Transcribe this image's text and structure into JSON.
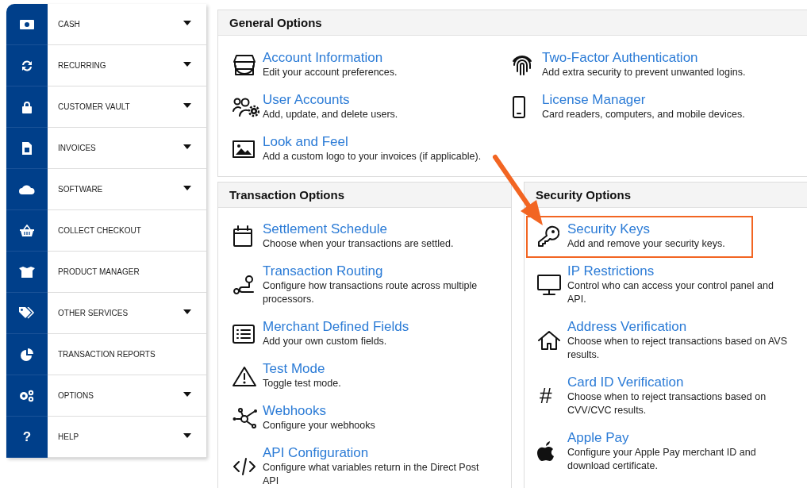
{
  "sidebar": {
    "items": [
      {
        "label": "CASH",
        "has_submenu": true
      },
      {
        "label": "RECURRING",
        "has_submenu": true
      },
      {
        "label": "CUSTOMER VAULT",
        "has_submenu": true
      },
      {
        "label": "INVOICES",
        "has_submenu": true
      },
      {
        "label": "SOFTWARE",
        "has_submenu": true
      },
      {
        "label": "COLLECT CHECKOUT",
        "has_submenu": false
      },
      {
        "label": "PRODUCT MANAGER",
        "has_submenu": false
      },
      {
        "label": "OTHER SERVICES",
        "has_submenu": true
      },
      {
        "label": "TRANSACTION REPORTS",
        "has_submenu": false
      },
      {
        "label": "OPTIONS",
        "has_submenu": true
      },
      {
        "label": "HELP",
        "has_submenu": true,
        "glyph": "?"
      }
    ]
  },
  "general_options": {
    "title": "General Options",
    "columns": [
      [
        {
          "title": "Account Information",
          "description": "Edit your account preferences.",
          "highlighted": false
        },
        {
          "title": "User Accounts",
          "description": "Add, update, and delete users.",
          "highlighted": false
        },
        {
          "title": "Look and Feel",
          "description": "Add a custom logo to your invoices (if applicable).",
          "highlighted": false
        }
      ],
      [
        {
          "title": "Two-Factor Authentication",
          "description": "Add extra security to prevent unwanted logins.",
          "highlighted": false
        },
        {
          "title": "License Manager",
          "description": "Card readers, computers, and mobile devices.",
          "highlighted": false
        }
      ]
    ]
  },
  "transaction_options": {
    "title": "Transaction Options",
    "items": [
      {
        "title": "Settlement Schedule",
        "description": "Choose when your transactions are settled.",
        "highlighted": false
      },
      {
        "title": "Transaction Routing",
        "description": "Configure how transactions route across multiple processors.",
        "highlighted": false
      },
      {
        "title": "Merchant Defined Fields",
        "description": "Add your own custom fields.",
        "highlighted": false
      },
      {
        "title": "Test Mode",
        "description": "Toggle test mode.",
        "highlighted": false
      },
      {
        "title": "Webhooks",
        "description": "Configure your webhooks",
        "highlighted": false
      },
      {
        "title": "API Configuration",
        "description": "Configure what variables return in the Direct Post API",
        "highlighted": false
      }
    ]
  },
  "security_options": {
    "title": "Security Options",
    "items": [
      {
        "title": "Security Keys",
        "description": "Add and remove your security keys.",
        "highlighted": true
      },
      {
        "title": "IP Restrictions",
        "description": "Control who can access your control panel and API.",
        "highlighted": false
      },
      {
        "title": "Address Verification",
        "description": "Choose when to reject transactions based on AVS results.",
        "highlighted": false
      },
      {
        "title": "Card ID Verification",
        "description": "Choose when to reject transactions based on CVV/CVC results.",
        "highlighted": false,
        "glyph": "#"
      },
      {
        "title": "Apple Pay",
        "description": "Configure your Apple Pay merchant ID and download certificate.",
        "highlighted": false
      }
    ]
  }
}
